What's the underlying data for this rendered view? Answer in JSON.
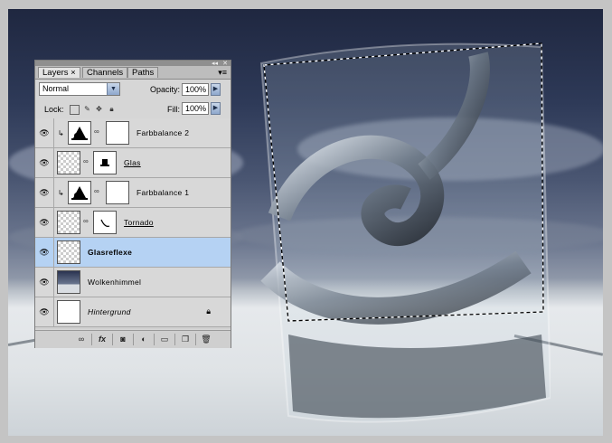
{
  "panel": {
    "tabs": [
      {
        "label": "Layers ×"
      },
      {
        "label": "Channels"
      },
      {
        "label": "Paths"
      }
    ],
    "blend_mode": "Normal",
    "opacity_label": "Opacity:",
    "opacity_value": "100%",
    "lock_label": "Lock:",
    "fill_label": "Fill:",
    "fill_value": "100%",
    "layers": [
      {
        "name": "Farbbalance 2",
        "type": "adjustment",
        "clipped": true
      },
      {
        "name": "Glas",
        "type": "image-mask",
        "underline": true
      },
      {
        "name": "Farbbalance 1",
        "type": "adjustment",
        "clipped": true
      },
      {
        "name": "Tornado",
        "type": "image-mask",
        "underline": true
      },
      {
        "name": "Glasreflexe",
        "type": "image",
        "selected": true
      },
      {
        "name": "Wolkenhimmel",
        "type": "image"
      },
      {
        "name": "Hintergrund",
        "type": "background",
        "locked": true
      }
    ]
  },
  "icons": {
    "visibility": "eye-icon",
    "lock": "lock-icon"
  },
  "colors": {
    "selected_layer": "#b5d2f3",
    "panel_bg": "#d6d6d6"
  }
}
